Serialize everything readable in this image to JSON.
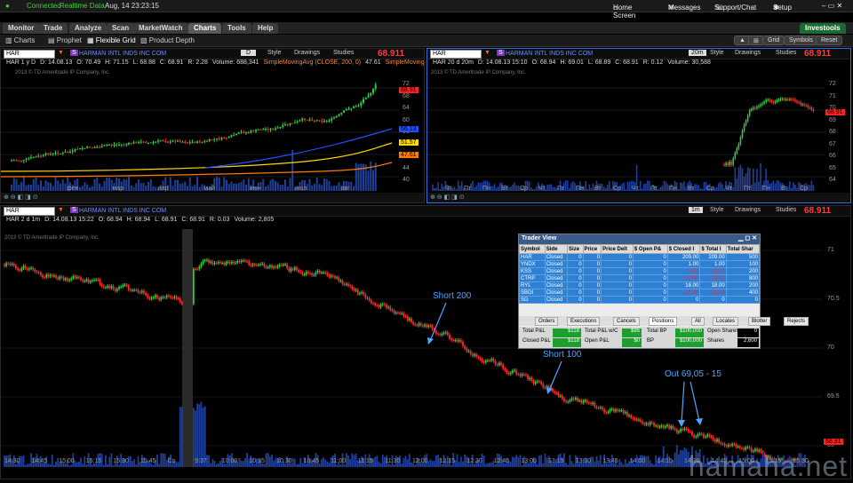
{
  "topbar": {
    "connected": "Connected",
    "realtime": "Realtime Data",
    "datetime": "Aug, 14  23:23:15",
    "home_screen": "Home Screen",
    "messages": "Messages",
    "support": "Support/Chat",
    "setup": "Setup"
  },
  "menu": {
    "tabs": [
      "Monitor",
      "Trade",
      "Analyze",
      "Scan",
      "MarketWatch",
      "Charts",
      "Tools",
      "Help"
    ],
    "investools": "Investools"
  },
  "subbar": {
    "charts": "Charts",
    "prophet": "Prophet",
    "flexible_grid": "Flexible Grid",
    "product_depth": "Product Depth",
    "grid": "Grid",
    "symbols": "Symbols",
    "reset": "Reset"
  },
  "panel1": {
    "symbol": "HAR",
    "period": "D",
    "company": "HARMAN INTL INDS INC COM",
    "style": "Style",
    "drawings": "Drawings",
    "studies": "Studies",
    "price": "68.911",
    "info": [
      "HAR 1 y D",
      "D: 14.08.13",
      "O: 70.49",
      "H: 71.15",
      "L: 68.88",
      "C: 68.91",
      "R: 2.28",
      "Volume: 688,341",
      "SimpleMovingAvg (CLOSE, 200, 0)",
      "47.61",
      "SimpleMovingAv"
    ],
    "copyright": "2013 © TD Ameritrade IP Company, Inc.",
    "x_labels": [
      "фев",
      "мар",
      "апр",
      "май",
      "июн",
      "июл",
      "авг"
    ],
    "y_labels": [
      "72",
      "68",
      "64",
      "60",
      "56",
      "52",
      "48",
      "44",
      "40"
    ],
    "tags": [
      {
        "text": "68.91",
        "color": "#ff2020"
      },
      {
        "text": "56.13",
        "color": "#2050ff"
      },
      {
        "text": "51.57",
        "color": "#ffd800"
      },
      {
        "text": "47.61",
        "color": "#ff7a00"
      }
    ]
  },
  "panel2": {
    "symbol": "HAR",
    "period": "20m",
    "company": "HARMAN INTL INDS INC COM",
    "style": "Style",
    "drawings": "Drawings",
    "studies": "Studies",
    "price": "68.911",
    "info": [
      "HAR 20 d 20m",
      "D: 14.08.13 15:10",
      "O: 68.94",
      "H: 69.01",
      "L: 68.89",
      "C: 68.91",
      "R: 0.12",
      "Volume: 30,588"
    ],
    "copyright": "2013 © TD Ameritrade IP Company, Inc.",
    "x_labels": [
      "Чт",
      "Пт",
      "Пн",
      "Вт",
      "Ср",
      "Чт",
      "Пт",
      "Пн",
      "Вт",
      "Ср",
      "Чт",
      "Пт",
      "Пн",
      "Вт",
      "Ср",
      "Чт",
      "Пт",
      "Пн",
      "Вт",
      "Ср"
    ],
    "y_labels": [
      "72",
      "71",
      "70",
      "69",
      "68",
      "67",
      "66",
      "65",
      "64"
    ],
    "tags": [
      {
        "text": "68.91",
        "color": "#ff2020"
      }
    ]
  },
  "panel3": {
    "symbol": "HAR",
    "period": "1m",
    "company": "HARMAN INTL INDS INC COM",
    "style": "Style",
    "drawings": "Drawings",
    "studies": "Studies",
    "price": "68.911",
    "info": [
      "HAR 2 d 1m",
      "D: 14.08.13 15:22",
      "O: 68.94",
      "H: 68.94",
      "L: 68.91",
      "C: 68.91",
      "R: 0.03",
      "Volume: 2,805"
    ],
    "copyright": "2013 © TD Ameritrade IP Company, Inc.",
    "x_labels": [
      "14:30",
      "14:45",
      "15:00",
      "15:15",
      "15:30",
      "15:45",
      "Ср",
      "9:37",
      "10:00",
      "10:15",
      "10:30",
      "10:45",
      "11:00",
      "11:15",
      "11:30",
      "12:00",
      "12:15",
      "12:30",
      "12:45",
      "13:00",
      "13:15",
      "13:30",
      "13:45",
      "14:00",
      "14:15",
      "14:30",
      "14:45",
      "15:00",
      "15:15",
      "15:30"
    ],
    "y_labels": [
      "71",
      "70.5",
      "70",
      "69.5",
      "69"
    ],
    "tags": [
      {
        "text": "68.91",
        "color": "#ff2020"
      }
    ]
  },
  "annotations": {
    "short200": "Short 200",
    "short100": "Short 100",
    "out": "Out 69,05 - 15"
  },
  "trader_view": {
    "title": "Trader View",
    "headers": [
      "Symbol",
      "Side",
      "Size",
      "Price",
      "Price Delt",
      "$ Open P&",
      "$ Closed I",
      "$ Total I",
      "Total Shar"
    ],
    "rows": [
      [
        "HAR",
        "Closed",
        "0",
        "0",
        "0",
        "0",
        "209.00",
        "209.00",
        "500"
      ],
      [
        "YNDX",
        "Closed",
        "0",
        "0",
        "0",
        "0",
        "1.00",
        "1.00",
        "100"
      ],
      [
        "KSS",
        "Closed",
        "0",
        "0",
        "0",
        "0",
        "-8.00",
        "-8.00",
        "200"
      ],
      [
        "CTRP",
        "Closed",
        "0",
        "0",
        "0",
        "0",
        "-72.00",
        "-72.00",
        "800"
      ],
      [
        "RYL",
        "Closed",
        "0",
        "0",
        "0",
        "0",
        "18.00",
        "18.00",
        "200"
      ],
      [
        "SBGI",
        "Closed",
        "0",
        "0",
        "0",
        "0",
        "-30.00",
        "-30.00",
        "400"
      ],
      [
        "SG",
        "Closed",
        "0",
        "0",
        "0",
        "0",
        "0",
        "0",
        "0"
      ]
    ],
    "tabs": [
      "Orders",
      "Executions",
      "Cancels",
      "Positions",
      "All",
      "Locates",
      "Blotter",
      "Rejects"
    ],
    "active_tab": "Positions",
    "summary": {
      "total_pl_label": "Total P&L",
      "total_pl": "$118",
      "total_pl_wfc_label": "Total P&L w/C",
      "total_pl_wfc": "$95",
      "total_bp_label": "Total BP",
      "total_bp": "$100,000",
      "open_shares_label": "Open Shares",
      "open_shares": "0",
      "closed_pl_label": "Closed P&L",
      "closed_pl": "$118",
      "open_pl_label": "Open P&L",
      "open_pl": "$0",
      "bp_label": "BP",
      "bp": "$100,000",
      "shares_label": "Shares",
      "shares": "2,600"
    }
  },
  "watermark": "hamaha.net",
  "colors": {
    "up": "#2ecc40",
    "down": "#ff2a2a",
    "volume": "#1f3f9a",
    "accent": "#3b5a88"
  }
}
